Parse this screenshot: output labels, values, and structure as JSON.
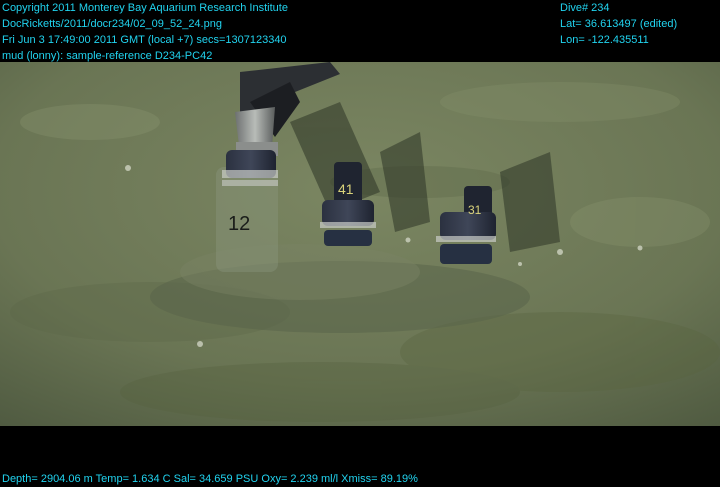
{
  "overlay": {
    "top_left": [
      "Copyright 2011 Monterey Bay Aquarium Research Institute",
      "DocRicketts/2011/docr234/02_09_52_24.png",
      "Fri Jun  3 17:49:00 2011 GMT (local +7)  secs=1307123340",
      "mud (lonny): sample-reference D234-PC42"
    ],
    "top_right": [
      "Dive# 234",
      "Lat= 36.613497 (edited)",
      "Lon= -122.435511"
    ],
    "bottom": "Depth= 2904.06 m  Temp= 1.634 C  Sal= 34.659 PSU  Oxy= 2.239 ml/l  Xmiss= 89.19%"
  },
  "scene": {
    "core_labels": [
      "12",
      "41",
      "31"
    ],
    "colors": {
      "seafloor": "#6f7a58",
      "seafloor_dark": "#4d583f",
      "overlay_text": "#21d3ef"
    }
  }
}
